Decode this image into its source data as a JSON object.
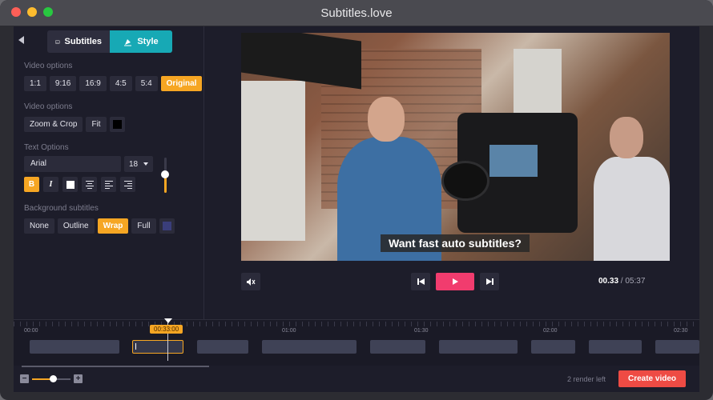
{
  "window": {
    "title": "Subtitles.love"
  },
  "tabs": [
    {
      "label": "Subtitles",
      "icon": "subtitles-icon"
    },
    {
      "label": "Style",
      "icon": "style-icon",
      "active": true
    }
  ],
  "video_options_aspect": {
    "label": "Video options",
    "options": [
      "1:1",
      "9:16",
      "16:9",
      "4:5",
      "5:4",
      "Original"
    ],
    "selected": "Original"
  },
  "video_options_fit": {
    "label": "Video options",
    "options": [
      "Zoom & Crop",
      "Fit"
    ],
    "swatch_color": "#000000"
  },
  "text_options": {
    "label": "Text Options",
    "font": "Arial",
    "size": "18",
    "slider_level": 0.55,
    "bold": "B",
    "italic": "I"
  },
  "background_subtitles": {
    "label": "Background subtitles",
    "options": [
      "None",
      "Outline",
      "Wrap",
      "Full"
    ],
    "selected": "Wrap",
    "swatch_color": "#3a3e7a"
  },
  "video": {
    "subtitle": "Want fast auto subtitles?"
  },
  "player": {
    "current_time": "00.33",
    "separator": " / ",
    "duration": "05:37"
  },
  "timeline": {
    "ticks": [
      "00:00",
      "01:00",
      "01:30",
      "02:00",
      "02:30"
    ],
    "playhead_time": "00:33:00"
  },
  "footer": {
    "render_left": "2 render left",
    "create_label": "Create video",
    "zoom_level": 0.55
  },
  "colors": {
    "accent": "#f6a623",
    "style_tab": "#17a9b5",
    "play_button": "#f13c6e",
    "create_button": "#ee4b44"
  }
}
